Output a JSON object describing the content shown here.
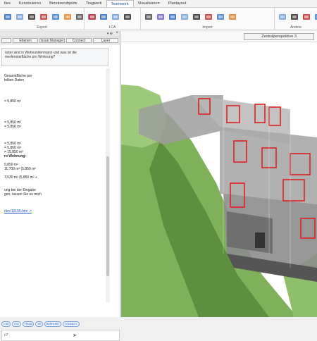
{
  "tabs": [
    "ttes",
    "Konstruieren",
    "Benutzerobjekte",
    "Tragwerk",
    "Teamwork",
    "Visualisieren",
    "Planlayout"
  ],
  "active_tab_index": 4,
  "ribbon": {
    "groups": [
      {
        "label": "Export",
        "icons": [
          "car-icon",
          "mesh-icon",
          "rhino-icon",
          "layers-icon",
          "blue-arrow-icon",
          "drop-icon",
          "stack-icon",
          "grid-icon",
          "doc-icon",
          "tablet-icon",
          "box-icon"
        ]
      },
      {
        "label": "LCA",
        "icons": [
          "lca-icon"
        ]
      },
      {
        "label": "Import",
        "icons": [
          "people-icon",
          "obj-icon",
          "import-icon",
          "rhino-import-icon",
          "import-arrows-icon",
          "ifc-icon",
          "cube-icon",
          "red-cube-icon"
        ]
      },
      {
        "label": "Ändere",
        "icons": [
          "pencil-icon",
          "pen-icon",
          "gear-icon",
          "red-arrow-icon"
        ]
      }
    ]
  },
  "left_panel": {
    "tabs": [
      "",
      "Ebenen",
      "Issue Manager",
      "Connect",
      "Layer"
    ],
    "question_lines": [
      "nster sind in Wohnunitenmann und was ist die",
      "merfensterfläche pro Wohnung?"
    ],
    "answer_lines": [
      {
        "t": "",
        "c": ""
      },
      {
        "t": "Gesamtfläche pro",
        "c": ""
      },
      {
        "t": "tellten Daten",
        "c": ""
      },
      {
        "t": "",
        "c": ""
      },
      {
        "t": "",
        "c": ""
      },
      {
        "t": "",
        "c": ""
      },
      {
        "t": "",
        "c": ""
      },
      {
        "t": "= 5,850 m²",
        "c": ""
      },
      {
        "t": "",
        "c": ""
      },
      {
        "t": "",
        "c": ""
      },
      {
        "t": "",
        "c": ""
      },
      {
        "t": "",
        "c": ""
      },
      {
        "t": "= 5,850 m²",
        "c": ""
      },
      {
        "t": "= 5,850 m²",
        "c": ""
      },
      {
        "t": "",
        "c": ""
      },
      {
        "t": "",
        "c": ""
      },
      {
        "t": "",
        "c": ""
      },
      {
        "t": "= 5,850 m²",
        "c": ""
      },
      {
        "t": "= 5,850 m²",
        "c": ""
      },
      {
        "t": "= 15,850 m²",
        "c": ""
      },
      {
        "t": "ro Wohnung:",
        "c": "bold"
      },
      {
        "t": "",
        "c": ""
      },
      {
        "t": "5,850 m²",
        "c": ""
      },
      {
        "t": "11,700 m² (5,850 m²",
        "c": ""
      },
      {
        "t": "",
        "c": ""
      },
      {
        "t": "7,530 m² (5,850 m² +",
        "c": ""
      },
      {
        "t": "",
        "c": ""
      },
      {
        "t": "",
        "c": ""
      },
      {
        "t": "ung bei der Eingabe",
        "c": ""
      },
      {
        "t": "gen, lassen Sie es mich",
        "c": ""
      },
      {
        "t": "",
        "c": ""
      },
      {
        "t": "",
        "c": ""
      },
      {
        "t": "",
        "c": ""
      },
      {
        "t": "rlen/10155.htm ↗",
        "c": "link"
      }
    ],
    "chips": [
      "CAA",
      "IDU",
      "TRIAD",
      "ZB",
      "BARRUNG",
      "CONNECT"
    ],
    "input_placeholder": "n?"
  },
  "viewport": {
    "label": "Zentralperspektive 3"
  },
  "colors": {
    "accent": "#1a4f8f",
    "window_red": "#e02020",
    "terrain": "#8fbf6a",
    "building_glass": "#b9b9b9"
  }
}
